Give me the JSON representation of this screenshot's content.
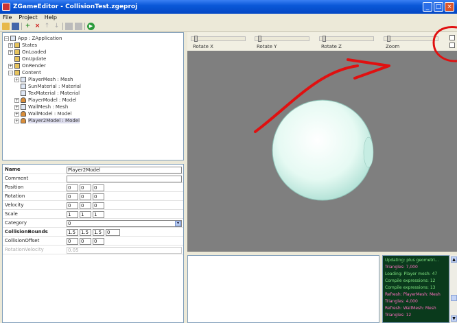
{
  "window": {
    "title": "ZGameEditor - CollisionTest.zgeproj",
    "minimize": "_",
    "maximize": "□",
    "close": "×"
  },
  "menu": [
    "File",
    "Project",
    "Help"
  ],
  "toolbar": {
    "add": "+",
    "delete": "×",
    "up": "↑",
    "down": "↓",
    "run": "▶"
  },
  "tree": {
    "nodes": [
      {
        "label": "App : ZApplication",
        "expander": "−"
      },
      {
        "label": "States",
        "expander": "+"
      },
      {
        "label": "OnLoaded",
        "expander": "+"
      },
      {
        "label": "OnUpdate",
        "expander": ""
      },
      {
        "label": "OnRender",
        "expander": "+"
      },
      {
        "label": "Content",
        "expander": "−"
      },
      {
        "label": "PlayerMesh : Mesh",
        "expander": "+"
      },
      {
        "label": "SunMaterial : Material",
        "expander": ""
      },
      {
        "label": "TexMaterial : Material",
        "expander": ""
      },
      {
        "label": "PlayerModel : Model",
        "expander": "+"
      },
      {
        "label": "WallMesh : Mesh",
        "expander": "+"
      },
      {
        "label": "WallModel : Model",
        "expander": "+"
      },
      {
        "label": "Player2Model : Model",
        "expander": "+"
      }
    ]
  },
  "properties": {
    "name": {
      "label": "Name",
      "value": "Player2Model"
    },
    "comment": {
      "label": "Comment",
      "value": ""
    },
    "position": {
      "label": "Position",
      "values": [
        "0",
        "0",
        "0"
      ]
    },
    "rotation": {
      "label": "Rotation",
      "values": [
        "0",
        "0",
        "0"
      ]
    },
    "velocity": {
      "label": "Velocity",
      "values": [
        "0",
        "0",
        "0"
      ]
    },
    "scale": {
      "label": "Scale",
      "values": [
        "1",
        "1",
        "1"
      ]
    },
    "category": {
      "label": "Category",
      "value": "0",
      "dropdown": "▾"
    },
    "collision_bounds": {
      "label": "CollisionBounds",
      "values": [
        "1.5",
        "1.5",
        "1.5",
        "0"
      ]
    },
    "collision_offset": {
      "label": "CollisionOffset",
      "values": [
        "0",
        "0",
        "0"
      ]
    },
    "rotation_velocity": {
      "label": "RotationVelocity",
      "value": "0.05"
    }
  },
  "preview": {
    "sliders": [
      {
        "label": "Rotate X"
      },
      {
        "label": "Rotate Y"
      },
      {
        "label": "Rotate Z"
      },
      {
        "label": "Zoom"
      }
    ]
  },
  "log": {
    "lines": [
      {
        "text": "Updating: plus geometri...",
        "color": "#7fe07f"
      },
      {
        "text": "  Triangles: 7,000",
        "color": "#ff6fc1"
      },
      {
        "text": "  Loading: Player mesh: 47",
        "color": "#7fe07f"
      },
      {
        "text": "Compile expressions: 12",
        "color": "#7fe07f"
      },
      {
        "text": "Compile expressions: 13",
        "color": "#7fe07f"
      },
      {
        "text": "Refresh: PlayerMesh: Mesh",
        "color": "#ff6fc1"
      },
      {
        "text": "  Triangles: 4,000",
        "color": "#ff6fc1"
      },
      {
        "text": "Refresh: WallMesh: Mesh",
        "color": "#ff6fc1"
      },
      {
        "text": "  Triangles: 12",
        "color": "#ff6fc1"
      }
    ]
  },
  "colors": {
    "viewport_bg": "#7f7f7f",
    "sphere": "#dff7f0",
    "annotation_red": "#e01010"
  }
}
